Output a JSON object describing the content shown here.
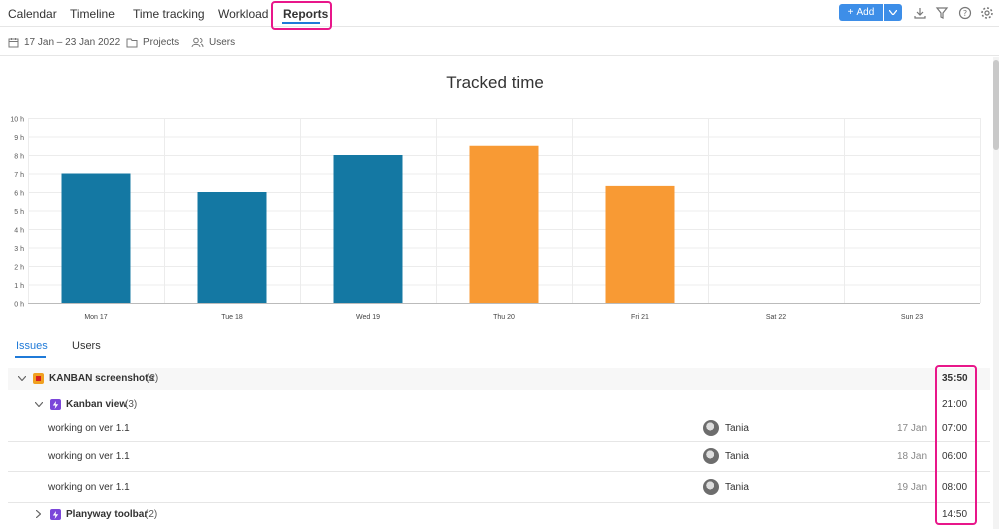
{
  "nav": {
    "tabs": [
      "Calendar",
      "Timeline",
      "Time tracking",
      "Workload",
      "Reports"
    ],
    "active_tab": "Reports",
    "add_label": "Add"
  },
  "filters": {
    "date_range": "17 Jan – 23 Jan 2022",
    "projects": "Projects",
    "users": "Users"
  },
  "chart_data": {
    "type": "bar",
    "title": "Tracked time",
    "categories": [
      "Mon 17",
      "Tue 18",
      "Wed 19",
      "Thu 20",
      "Fri 21",
      "Sat 22",
      "Sun 23"
    ],
    "values": [
      7,
      6,
      8,
      8.5,
      6.33,
      0,
      0
    ],
    "colors": [
      "#1478a3",
      "#1478a3",
      "#1478a3",
      "#f89a34",
      "#f89a34",
      "#1478a3",
      "#1478a3"
    ],
    "yticks": [
      "0 h",
      "1 h",
      "2 h",
      "3 h",
      "4 h",
      "5 h",
      "6 h",
      "7 h",
      "8 h",
      "9 h",
      "10 h"
    ],
    "ylim": [
      0,
      10
    ],
    "grid": true
  },
  "report_tabs": [
    "Issues",
    "Users"
  ],
  "rows": {
    "group": {
      "name": "KANBAN screenshots",
      "count": "(2)",
      "total": "35:50"
    },
    "sub1": {
      "name": "Kanban view",
      "count": "(3)",
      "total": "21:00"
    },
    "entries": [
      {
        "task": "working on ver 1.1",
        "user": "Tania",
        "date": "17 Jan",
        "time": "07:00"
      },
      {
        "task": "working on ver 1.1",
        "user": "Tania",
        "date": "18 Jan",
        "time": "06:00"
      },
      {
        "task": "working on ver 1.1",
        "user": "Tania",
        "date": "19 Jan",
        "time": "08:00"
      }
    ],
    "sub2": {
      "name": "Planyway toolbar",
      "count": "(2)",
      "total": "14:50"
    }
  },
  "colors": {
    "accent": "#1f7ad8",
    "highlight": "#e8178a",
    "bar_blue": "#1478a3",
    "bar_orange": "#f89a34"
  }
}
